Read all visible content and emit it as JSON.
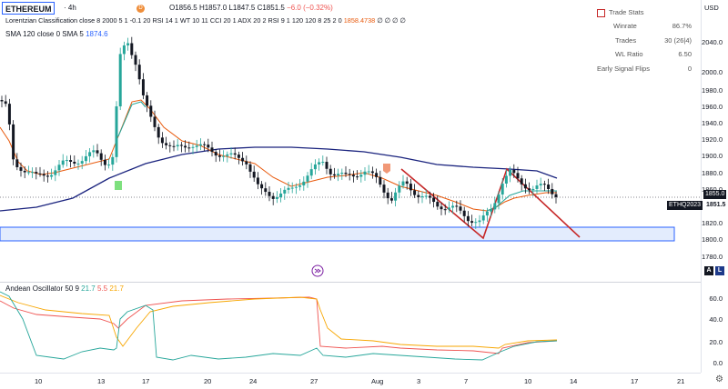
{
  "symbol": {
    "name": "ETHEREUM",
    "timeframe": "4h"
  },
  "ohlc": {
    "o": "O1856.5",
    "h": "H1857.0",
    "l": "L1847.5",
    "c": "C1851.5",
    "chg": "−6.0 (−0.32%)"
  },
  "indicators": [
    {
      "label": "Lorentzian Classification close 8 2000 5 1 -0.1 20 RSI 14 1 WT 10 11 CCI 20 1 ADX 20 2 RSI 9 1 120 120 8 25 2 0",
      "value": "1858.4738",
      "value_color": "#e8590c",
      "tail": "∅ ∅ ∅ ∅"
    },
    {
      "label": "SMA 120 close 0 SMA 5",
      "value": "1874.6",
      "value_color": "#2962ff"
    }
  ],
  "oscillator": {
    "label": "Andean Oscillator 50 9",
    "v1": "21.7",
    "v2": "5.5",
    "v3": "21.7",
    "c1": "#26a69a",
    "c2": "#ef5350",
    "c3": "#f7a600"
  },
  "currency": "USD",
  "trade_stats": {
    "title": "Trade Stats",
    "rows": [
      {
        "label": "Winrate",
        "value": "86.7%"
      },
      {
        "label": "Trades",
        "value": "30 (26|4)"
      },
      {
        "label": "WL Ratio",
        "value": "6.50"
      },
      {
        "label": "Early Signal Flips",
        "value": "0"
      }
    ]
  },
  "price_axis": [
    "2040.0",
    "2000.0",
    "1980.0",
    "1960.0",
    "1940.0",
    "1920.0",
    "1900.0",
    "1880.0",
    "1860.0",
    "1820.0",
    "1800.0",
    "1780.0"
  ],
  "price_tags": {
    "dark": "1855.0",
    "dark_label": "ETHQ2023",
    "light": "1851.5"
  },
  "osc_axis": [
    "60.0",
    "40.0",
    "20.0",
    "0.0"
  ],
  "date_axis": [
    "10",
    "13",
    "17",
    "20",
    "24",
    "27",
    "Aug",
    "3",
    "7",
    "10",
    "14",
    "17",
    "21"
  ],
  "buttons": {
    "a": "A",
    "l": "L"
  },
  "colors": {
    "up": "#26a69a",
    "down": "#131722",
    "sma": "#1a237e",
    "ema": "#e8590c",
    "zone": "#2962ff",
    "pattern": "#c62828"
  }
}
